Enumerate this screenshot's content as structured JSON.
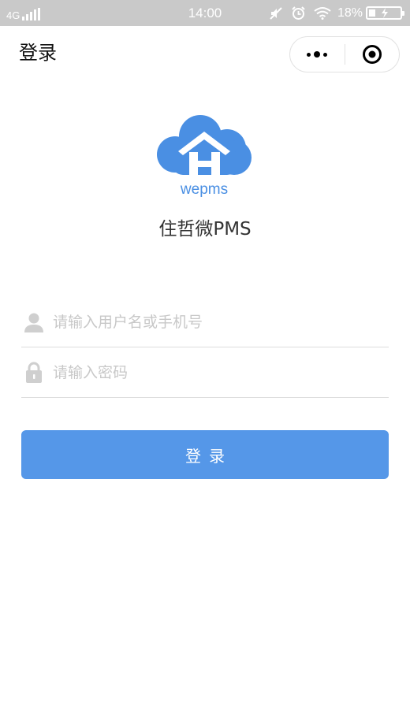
{
  "status_bar": {
    "network": "4G",
    "time": "14:00",
    "battery_percent": "18%",
    "icons": [
      "signal-icon",
      "mute-icon",
      "alarm-icon",
      "wifi-icon",
      "battery-charging-icon"
    ]
  },
  "navbar": {
    "title": "登录",
    "more_icon": "more-dots-icon",
    "close_icon": "target-circle-icon"
  },
  "logo": {
    "text": "wepms",
    "icon": "cloud-house-icon",
    "color": "#4a8fe3"
  },
  "app_name": "住哲微PMS",
  "form": {
    "username_placeholder": "请输入用户名或手机号",
    "username_value": "",
    "password_placeholder": "请输入密码",
    "password_value": ""
  },
  "login_button": {
    "label": "登录",
    "color": "#5597e8"
  }
}
